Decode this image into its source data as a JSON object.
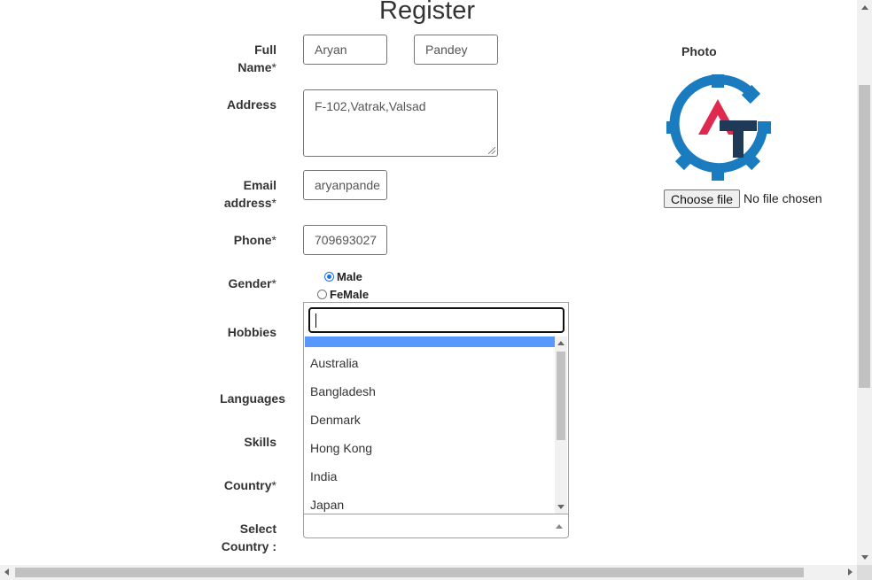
{
  "page": {
    "title": "Register"
  },
  "form": {
    "full_name_label": "Full",
    "full_name_label2": "Name",
    "first_name_value": "Aryan",
    "last_name_value": "Pandey",
    "address_label": "Address",
    "address_value": "F-102,Vatrak,Valsad",
    "email_label": "Email",
    "email_label2": "address",
    "email_value": "aryanpande",
    "phone_label": "Phone",
    "phone_value": "709693027",
    "gender_label": "Gender",
    "gender_options": [
      "Male",
      "FeMale"
    ],
    "gender_selected": "Male",
    "hobbies_label": "Hobbies",
    "languages_label": "Languages",
    "skills_label": "Skills",
    "country_label": "Country",
    "select_country_label": "Select",
    "select_country_label2": "Country :",
    "required_mark": "*"
  },
  "country_dropdown": {
    "search_value": "",
    "options": [
      "",
      "Australia",
      "Bangladesh",
      "Denmark",
      "Hong Kong",
      "India",
      "Japan"
    ],
    "highlighted_index": 0
  },
  "photo": {
    "label": "Photo",
    "choose_button": "Choose file",
    "status": "No file chosen",
    "logo_icon": "automation-testing-gear-logo",
    "logo_colors": {
      "gear": "#1a7bbf",
      "a": "#e0294f",
      "t": "#1f3a57"
    }
  }
}
